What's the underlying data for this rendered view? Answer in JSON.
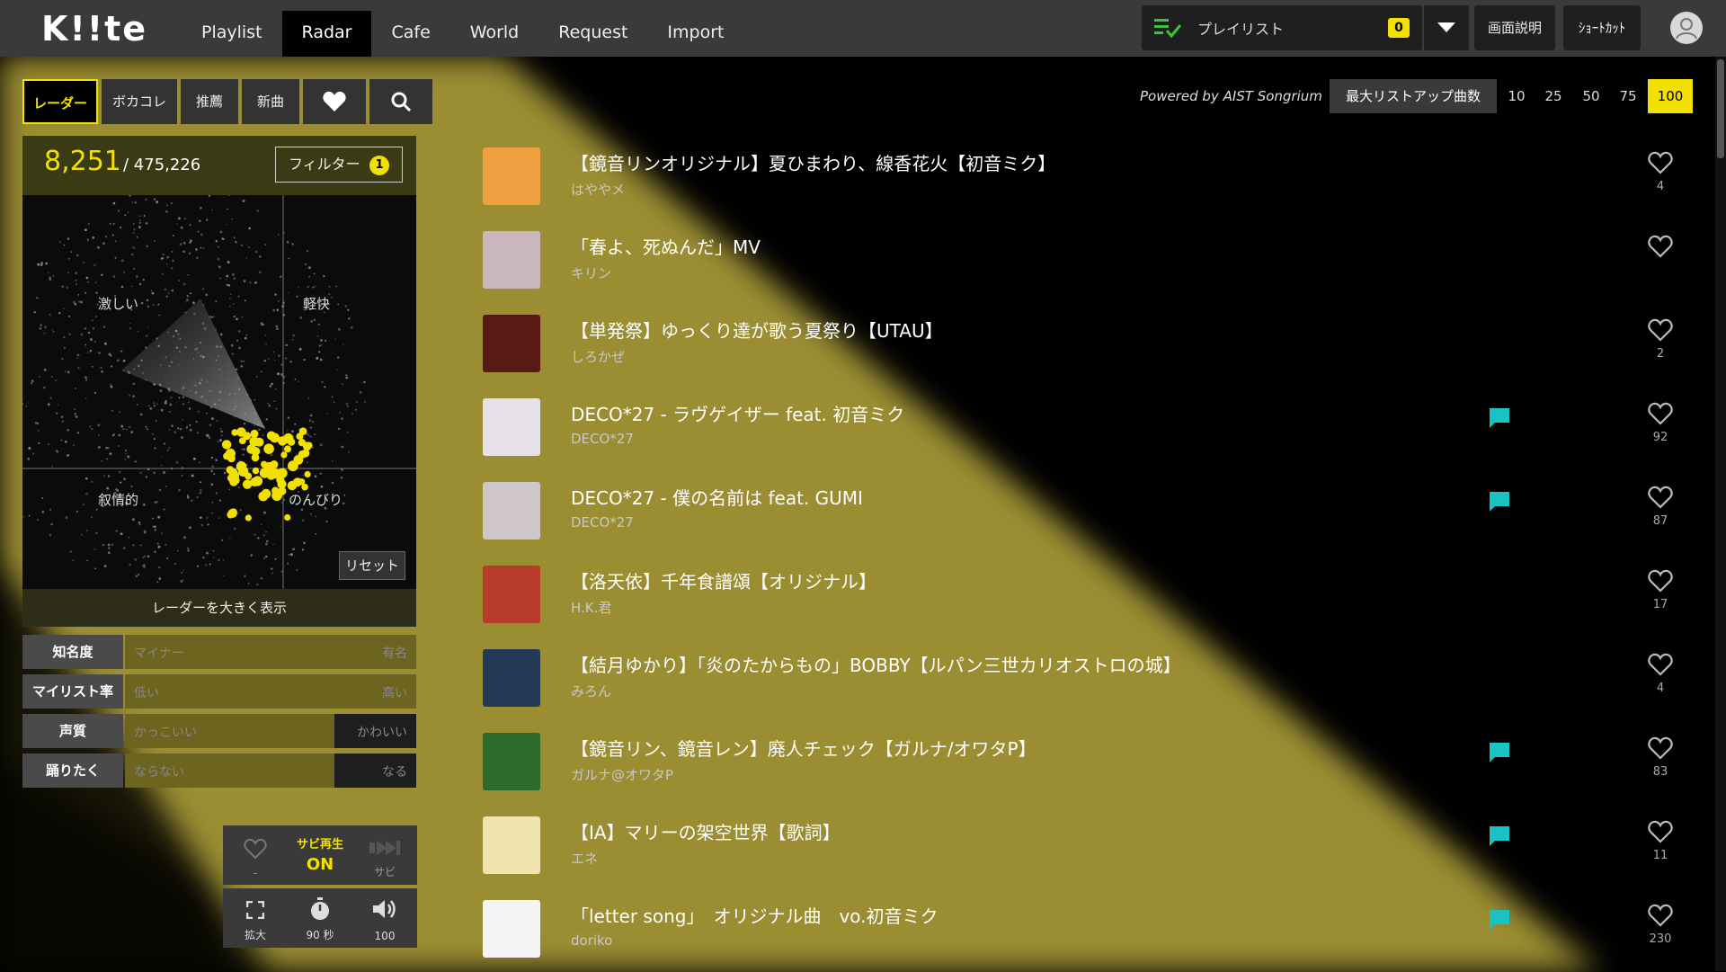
{
  "header": {
    "logo": "K!!te",
    "nav": [
      "Playlist",
      "Radar",
      "Cafe",
      "World",
      "Request",
      "Import"
    ],
    "active_nav": "Radar",
    "playlist_label": "プレイリスト",
    "playlist_count": "0",
    "screen_help": "画面説明",
    "shortcut": "ｼｮｰﾄｶｯﾄ"
  },
  "left": {
    "tabs": [
      "レーダー",
      "ボカコレ",
      "推薦",
      "新曲"
    ],
    "count": "8,251",
    "total": "/  475,226",
    "filter_label": "フィルター",
    "filter_count": "1",
    "radar_labels": {
      "tl": "激しい",
      "tr": "軽快",
      "bl": "叙情的",
      "br": "のんびり"
    },
    "reset": "リセット",
    "expand": "レーダーを大きく表示",
    "sliders": [
      {
        "key": "知名度",
        "lo": "マイナー",
        "hi": "有名",
        "fill": 1.0
      },
      {
        "key": "マイリスト率",
        "lo": "低い",
        "hi": "高い",
        "fill": 1.0
      },
      {
        "key": "声質",
        "lo": "かっこいい",
        "hi": "かわいい",
        "fill": 0.72
      },
      {
        "key": "踊りたく",
        "lo": "ならない",
        "hi": "なる",
        "fill": 0.72
      }
    ],
    "controls": {
      "like_label": "-",
      "sabi_play_label": "サビ再生",
      "sabi_play_state": "ON",
      "sabi_label": "サビ",
      "expand_label": "拡大",
      "timer_label": "90 秒",
      "volume_label": "100"
    }
  },
  "right": {
    "powered": "Powered by AIST Songrium",
    "max_list": "最大リストアップ曲数",
    "num_options": [
      "10",
      "25",
      "50",
      "75",
      "100"
    ],
    "selected_num": "100"
  },
  "songs": [
    {
      "title": "【鏡音リンオリジナル】夏ひまわり、線香花火【初音ミク】",
      "artist": "はややメ",
      "likes": "4",
      "comment": false,
      "thumb": "#f0a040"
    },
    {
      "title": "「春よ、死ぬんだ」MV",
      "artist": "キリン",
      "likes": "",
      "comment": false,
      "thumb": "#c9b7bd"
    },
    {
      "title": "【単発祭】ゆっくり達が歌う夏祭り【UTAU】",
      "artist": "しろかぜ",
      "likes": "2",
      "comment": false,
      "thumb": "#5a1a14"
    },
    {
      "title": "DECO*27 - ラヴゲイザー feat. 初音ミク",
      "artist": "DECO*27",
      "likes": "92",
      "comment": true,
      "thumb": "#e7e2ea"
    },
    {
      "title": "DECO*27 - 僕の名前は feat. GUMI",
      "artist": "DECO*27",
      "likes": "87",
      "comment": true,
      "thumb": "#cfc6c8"
    },
    {
      "title": "【洛天依】千年食譜頌【オリジナル】",
      "artist": "H.K.君",
      "likes": "17",
      "comment": false,
      "thumb": "#b83a2a"
    },
    {
      "title": "【結月ゆかり】「炎のたからもの」BOBBY【ルパン三世カリオストロの城】",
      "artist": "みろん",
      "likes": "4",
      "comment": false,
      "thumb": "#223a55"
    },
    {
      "title": "【鏡音リン、鏡音レン】廃人チェック【ガルナ/オワタP】",
      "artist": "ガルナ@オワタP",
      "likes": "83",
      "comment": true,
      "thumb": "#2a6a2a"
    },
    {
      "title": "【IA】マリーの架空世界【歌詞】",
      "artist": "エネ",
      "likes": "11",
      "comment": true,
      "thumb": "#efe3b0"
    },
    {
      "title": "「letter song」　オリジナル曲　vo.初音ミク",
      "artist": "doriko",
      "likes": "230",
      "comment": true,
      "thumb": "#f4f4f4"
    }
  ],
  "colors": {
    "accent": "#f2e100",
    "beam": "#c8b84a",
    "comment": "#19c3c3"
  },
  "icons": [
    "playlist-check-icon",
    "chevron-down-icon",
    "user-icon",
    "heart-icon",
    "search-icon",
    "comment-icon",
    "expand-icon",
    "timer-icon",
    "volume-icon",
    "skip-icon"
  ]
}
